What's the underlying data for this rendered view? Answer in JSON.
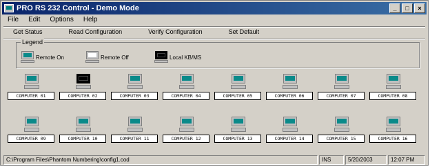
{
  "window": {
    "title": "PRO RS 232 Control - Demo Mode"
  },
  "menu": [
    "File",
    "Edit",
    "Options",
    "Help"
  ],
  "toolbar": [
    "Get Status",
    "Read Configuration",
    "Verify Configuration",
    "Set Default"
  ],
  "legend": {
    "title": "Legend",
    "items": [
      {
        "label": "Remote On",
        "icon": "remote-on-computer-icon"
      },
      {
        "label": "Remote Off",
        "icon": "remote-off-computer-icon"
      },
      {
        "label": "Local KB/MS",
        "icon": "local-computer-icon"
      }
    ]
  },
  "computers": [
    {
      "label": "COMPUTER 01",
      "state": "on"
    },
    {
      "label": "COMPUTER 02",
      "state": "local"
    },
    {
      "label": "COMPUTER 03",
      "state": "on"
    },
    {
      "label": "COMPUTER 04",
      "state": "on"
    },
    {
      "label": "COMPUTER 05",
      "state": "on"
    },
    {
      "label": "COMPUTER 06",
      "state": "on"
    },
    {
      "label": "COMPUTER 07",
      "state": "on"
    },
    {
      "label": "COMPUTER 08",
      "state": "on"
    },
    {
      "label": "COMPUTER 09",
      "state": "on"
    },
    {
      "label": "COMPUTER 10",
      "state": "on"
    },
    {
      "label": "COMPUTER 11",
      "state": "on"
    },
    {
      "label": "COMPUTER 12",
      "state": "on"
    },
    {
      "label": "COMPUTER 13",
      "state": "on"
    },
    {
      "label": "COMPUTER 14",
      "state": "on"
    },
    {
      "label": "COMPUTER 15",
      "state": "on"
    },
    {
      "label": "COMPUTER 16",
      "state": "on"
    }
  ],
  "status": {
    "path": "C:\\Program Files\\Phantom Numbering\\config1.cod",
    "ins": "INS",
    "date": "5/20/2003",
    "time": "12:07 PM"
  }
}
